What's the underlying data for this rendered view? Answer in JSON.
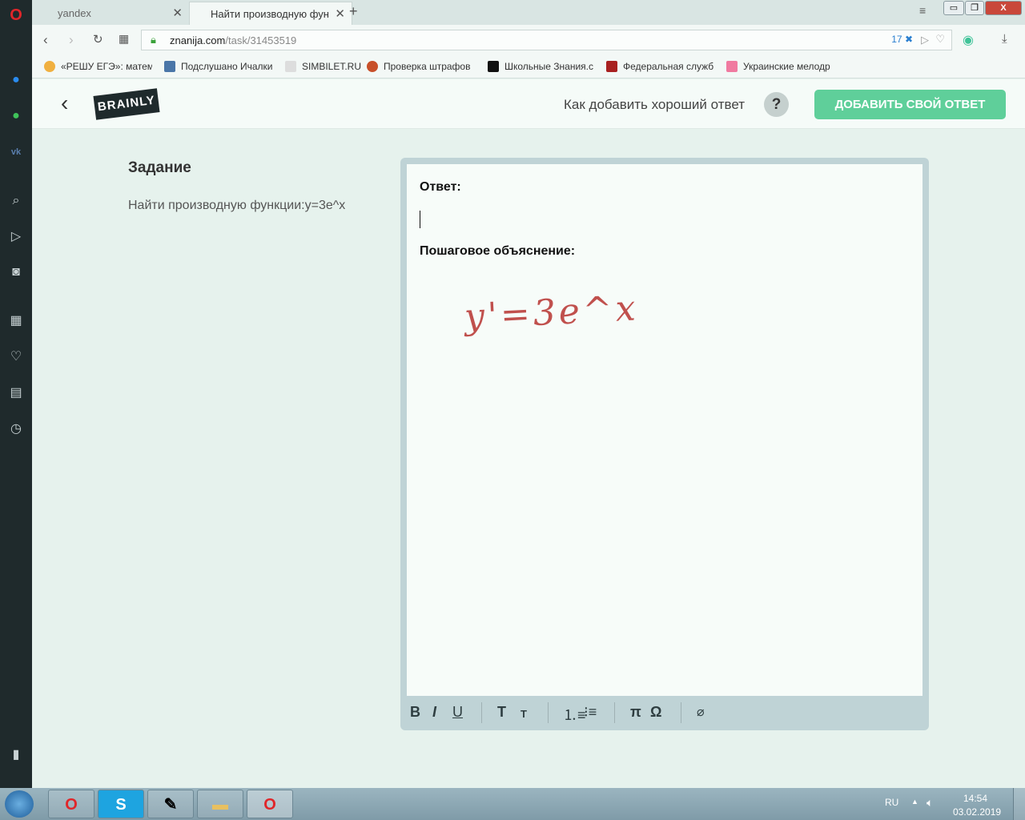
{
  "browser": {
    "tabs": [
      {
        "label": "yandex",
        "active": false
      },
      {
        "label": "Найти производную фун",
        "active": true
      }
    ],
    "url_host": "znanija.com",
    "url_path": "/task/31453519",
    "adblock_count": "17",
    "bookmarks": [
      "«РЕШУ ЕГЭ»: матема",
      "Подслушано Ичалки",
      "SIMBILET.RU",
      "Проверка штрафов",
      "Школьные Знания.c",
      "Федеральная служб",
      "Украинские мелодр"
    ]
  },
  "header": {
    "logo": "BRAINLY",
    "howto": "Как добавить хороший ответ",
    "help": "?",
    "add_answer": "ДОБАВИТЬ СВОЙ ОТВЕТ"
  },
  "task": {
    "heading": "Задание",
    "text": "Найти производную функции:y=3e^x"
  },
  "editor": {
    "answer_label": "Ответ:",
    "answer_value": "",
    "explanation_label": "Пошаговое объяснение:",
    "handwritten": "y'=3e^x",
    "toolbar": {
      "bold": "B",
      "italic": "I",
      "underline": "U",
      "text_large": "T",
      "text_small": "T",
      "pi": "π",
      "omega": "Ω"
    },
    "ink_color": "#c0504d"
  },
  "taskbar": {
    "lang": "RU",
    "time": "14:54",
    "date": "03.02.2019"
  }
}
